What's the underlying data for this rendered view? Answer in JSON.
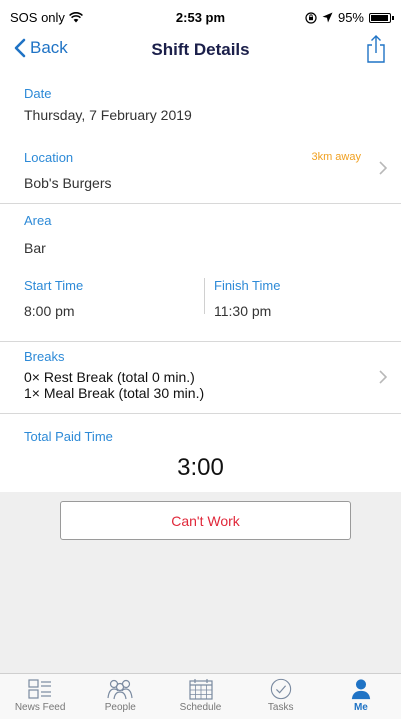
{
  "status_bar": {
    "carrier": "SOS only",
    "time": "2:53 pm",
    "battery": "95%",
    "battery_level": 0.95
  },
  "nav": {
    "back_label": "Back",
    "title": "Shift Details"
  },
  "shift": {
    "date_label": "Date",
    "date_value": "Thursday, 7 February 2019",
    "location_label": "Location",
    "location_distance": "3km away",
    "location_value": "Bob's Burgers",
    "area_label": "Area",
    "area_value": "Bar",
    "start_label": "Start Time",
    "start_value": "8:00 pm",
    "finish_label": "Finish Time",
    "finish_value": "11:30 pm",
    "breaks_label": "Breaks",
    "breaks": [
      "0× Rest Break (total 0 min.)",
      "1× Meal Break (total 30 min.)"
    ],
    "total_label": "Total Paid Time",
    "total_value": "3:00"
  },
  "actions": {
    "cant_work_label": "Can't Work"
  },
  "tabs": [
    {
      "label": "News Feed",
      "icon": "news-feed-icon"
    },
    {
      "label": "People",
      "icon": "people-icon"
    },
    {
      "label": "Schedule",
      "icon": "calendar-icon"
    },
    {
      "label": "Tasks",
      "icon": "checkmark-circle-icon"
    },
    {
      "label": "Me",
      "icon": "person-icon",
      "active": true
    }
  ],
  "colors": {
    "accent": "#1f73c5",
    "label_blue": "#2d8ad7",
    "distance_orange": "#f0a020",
    "danger_red": "#e0283a"
  }
}
